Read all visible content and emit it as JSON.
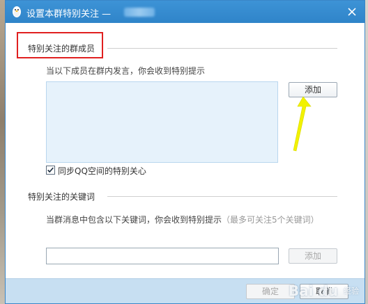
{
  "window": {
    "title": "设置本群特别关注 —"
  },
  "members_section": {
    "title": "特别关注的群成员",
    "hint": "当以下成员在群内发言，你会收到特别提示",
    "add_button": "添加",
    "sync_checkbox_label": "同步QQ空间的特别关心",
    "sync_checked": true
  },
  "keywords_section": {
    "title": "特别关注的关键词",
    "hint": "当群消息中包含以下关键词，你会收到特别提示",
    "hint_note": "（最多可关注5个关键词）",
    "input_value": "",
    "add_button": "添加"
  },
  "footer": {
    "confirm_button": "确定",
    "cancel_button": "取消"
  },
  "watermark": {
    "logo_text": "Bai du",
    "sub_text": "经验"
  },
  "colors": {
    "titlebar": "#3d93d6",
    "highlight_box": "#e02020",
    "arrow": "#f2f200",
    "member_list_bg": "#e6f2fb",
    "footer_bg": "#c7dff2"
  },
  "icons": {
    "title_icon": "qq-penguin-icon",
    "close_icon": "close-icon",
    "check_icon": "checkmark-icon"
  }
}
